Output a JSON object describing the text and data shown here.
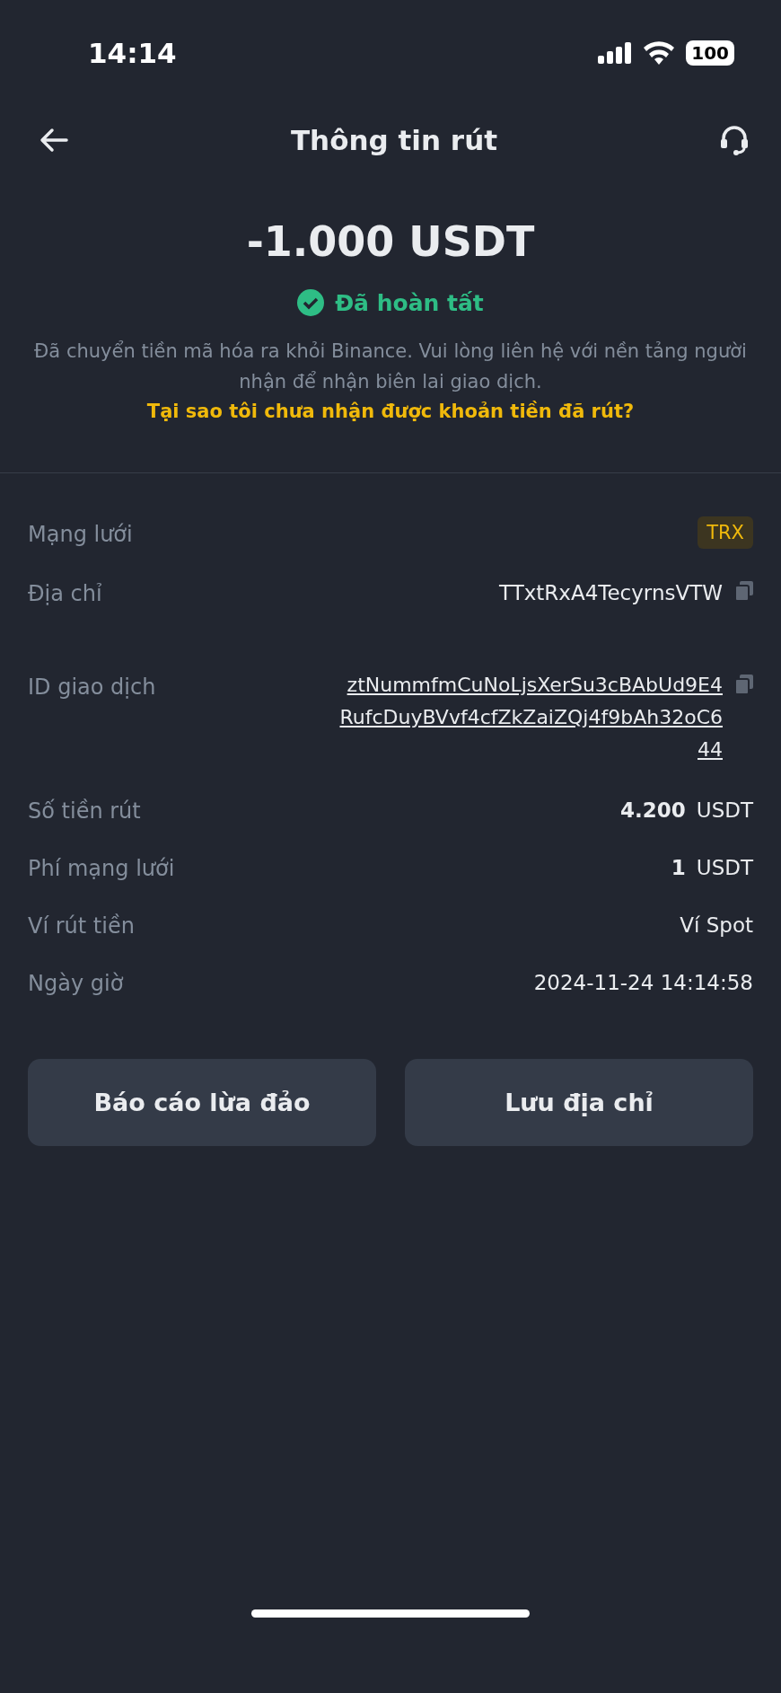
{
  "status_bar": {
    "time": "14:14",
    "battery": "100"
  },
  "header": {
    "title": "Thông tin rút"
  },
  "summary": {
    "amount": "-1.000 USDT",
    "status": "Đã hoàn tất",
    "description": "Đã chuyển tiền mã hóa ra khỏi Binance. Vui lòng liên hệ với nền tảng người nhận để nhận biên lai giao dịch.",
    "help_link": "Tại sao tôi chưa nhận được khoản tiền đã rút?"
  },
  "details": [
    {
      "kind": "badge",
      "label": "Mạng lưới",
      "value": "TRX"
    },
    {
      "kind": "copy",
      "label": "Địa chỉ",
      "value": "TTxtRxA4TecyrnsVTW"
    },
    {
      "kind": "link_copy",
      "label": "ID giao dịch",
      "value": "ztNummfmCuNoLjsXerSu3cBAbUd9E4RufcDuyBVvf4cfZkZaiZQj4f9bAh32oC644"
    },
    {
      "kind": "amount",
      "label": "Số tiền rút",
      "value": "4.200",
      "unit": "USDT"
    },
    {
      "kind": "amount",
      "label": "Phí mạng lưới",
      "value": "1",
      "unit": "USDT"
    },
    {
      "kind": "text",
      "label": "Ví rút tiền",
      "value": "Ví Spot"
    },
    {
      "kind": "text",
      "label": "Ngày giờ",
      "value": "2024-11-24 14:14:58"
    }
  ],
  "buttons": [
    "Báo cáo lừa đảo",
    "Lưu địa chỉ"
  ]
}
